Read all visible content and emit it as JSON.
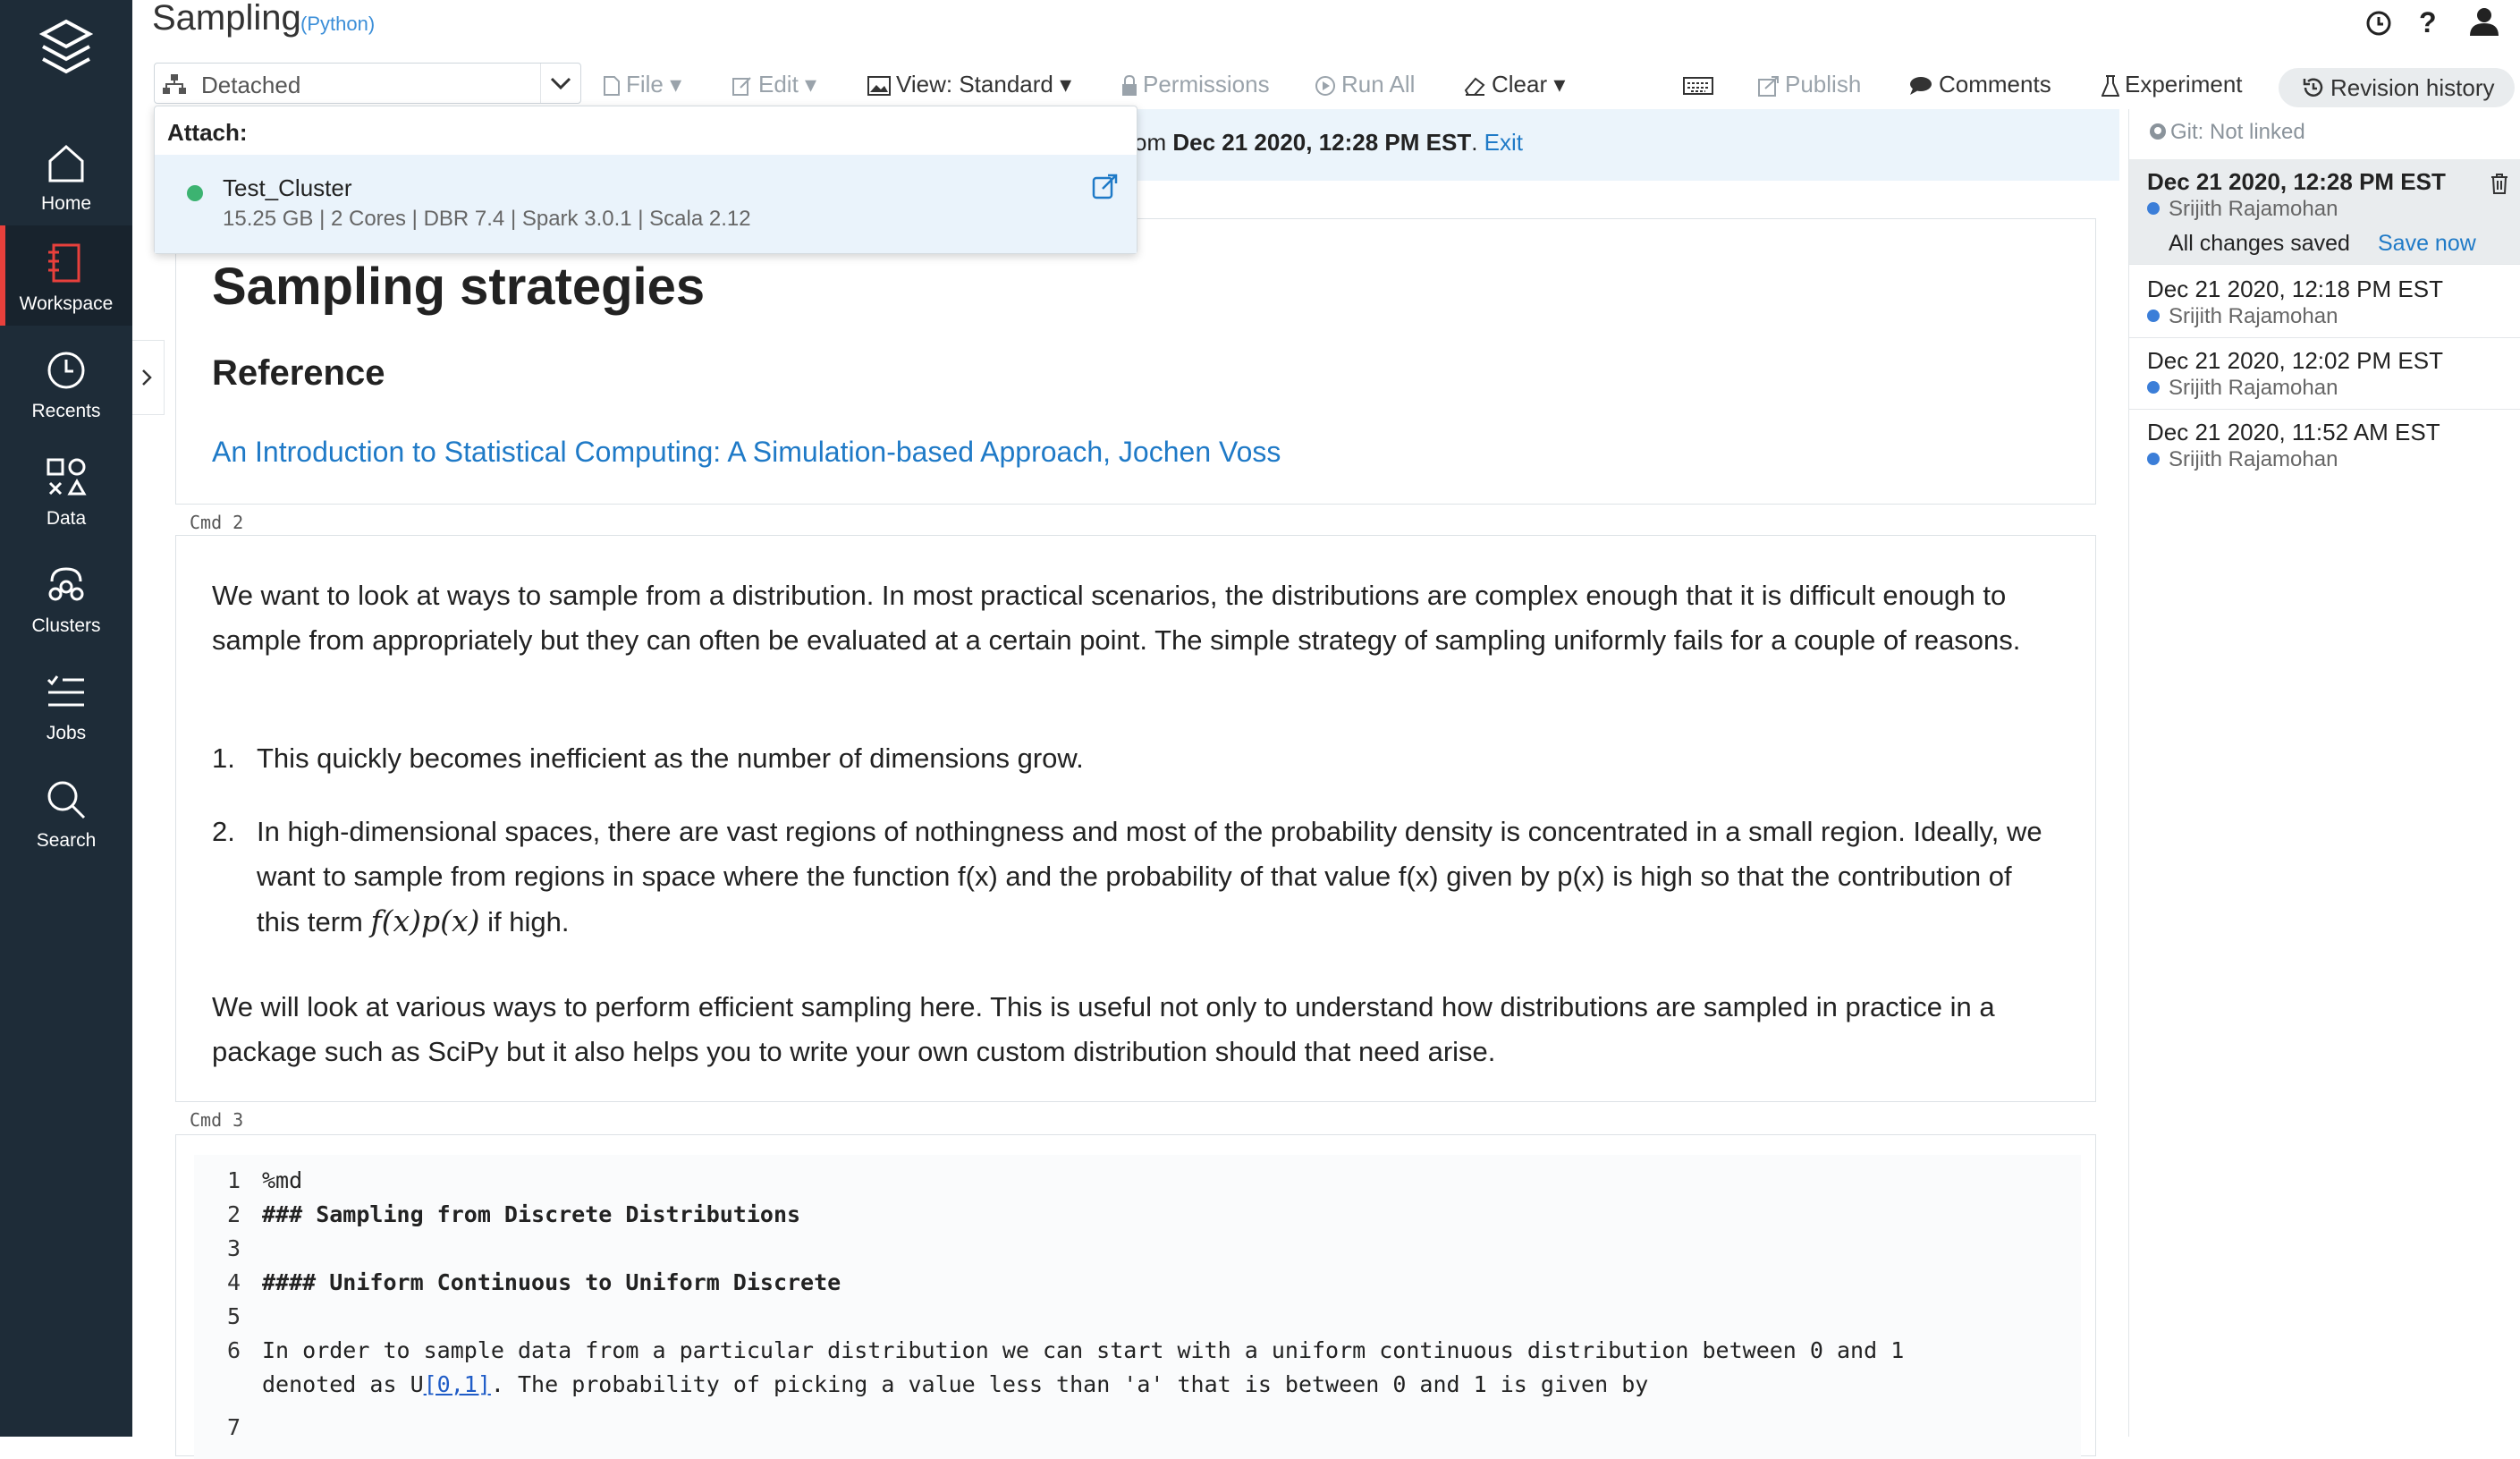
{
  "nav": {
    "items": [
      {
        "label": "Home",
        "icon": "home-icon"
      },
      {
        "label": "Workspace",
        "icon": "workspace-icon",
        "active": true
      },
      {
        "label": "Recents",
        "icon": "clock-icon"
      },
      {
        "label": "Data",
        "icon": "data-icon"
      },
      {
        "label": "Clusters",
        "icon": "clusters-icon"
      },
      {
        "label": "Jobs",
        "icon": "jobs-icon"
      },
      {
        "label": "Search",
        "icon": "search-icon"
      }
    ]
  },
  "header": {
    "title": "Sampling",
    "language": "(Python)"
  },
  "toolbar": {
    "cluster_value": "Detached",
    "file": "File",
    "edit": "Edit",
    "view": "View: Standard",
    "permissions": "Permissions",
    "run_all": "Run All",
    "clear": "Clear",
    "publish": "Publish",
    "comments": "Comments",
    "experiment": "Experiment",
    "revision_history": "Revision history"
  },
  "dropdown": {
    "header": "Attach:",
    "cluster_name": "Test_Cluster",
    "cluster_specs": "15.25 GB | 2 Cores | DBR 7.4 | Spark 3.0.1 | Scala 2.12",
    "status_color": "#3cb371"
  },
  "banner": {
    "prefix": "om ",
    "date": "Dec 21 2020, 12:28 PM EST",
    "suffix": ". ",
    "exit": "Exit"
  },
  "cells": {
    "cell1": {
      "h1": "Sampling strategies",
      "h2": "Reference",
      "link": "An Introduction to Statistical Computing: A Simulation-based Approach, Jochen Voss"
    },
    "cmd2": "Cmd 2",
    "cell2": {
      "p1": "We want to look at ways to sample from a distribution. In most practical scenarios, the distributions are complex enough that it is difficult enough to sample from appropriately but they can often be evaluated at a certain point. The simple strategy of sampling uniformly fails for a couple of reasons.",
      "li1_num": "1.",
      "li1": "This quickly becomes inefficient as the number of dimensions grow.",
      "li2_num": "2.",
      "li2_a": "In high-dimensional spaces, there are vast regions of nothingness and most of the probability density is concentrated in a small region. Ideally, we want to sample from regions in space where the function f(x) and the probability of that value f(x) given by p(x) is high so that the contribution of this term ",
      "li2_math": "f(x)p(x)",
      "li2_b": " if high.",
      "p2": "We will look at various ways to perform efficient sampling here. This is useful not only to understand how distributions are sampled in practice in a package such as SciPy but it also helps you to write your own custom distribution should that need arise."
    },
    "cmd3": "Cmd 3",
    "code": [
      {
        "n": "1",
        "text": "%md"
      },
      {
        "n": "2",
        "text": "### Sampling from Discrete Distributions"
      },
      {
        "n": "3",
        "text": ""
      },
      {
        "n": "4",
        "text": "#### Uniform Continuous to Uniform Discrete"
      },
      {
        "n": "5",
        "text": ""
      },
      {
        "n": "6",
        "text": "In order to sample data from a particular distribution we can start with a uniform continuous distribution between 0 and 1"
      },
      {
        "n": "",
        "text_a": "denoted as U",
        "text_link": "[0,1]",
        "text_b": ". The probability of picking a value less than 'a' that is between 0 and 1 is given by"
      },
      {
        "n": "7",
        "text": ""
      }
    ]
  },
  "revisions": {
    "git": "Git: Not linked",
    "items": [
      {
        "date": "Dec 21 2020, 12:28 PM EST",
        "user": "Srijith Rajamohan",
        "saved": "All changes saved",
        "save_now": "Save now"
      },
      {
        "date": "Dec 21 2020, 12:18 PM EST",
        "user": "Srijith Rajamohan"
      },
      {
        "date": "Dec 21 2020, 12:02 PM EST",
        "user": "Srijith Rajamohan"
      },
      {
        "date": "Dec 21 2020, 11:52 AM EST",
        "user": "Srijith Rajamohan"
      }
    ]
  }
}
